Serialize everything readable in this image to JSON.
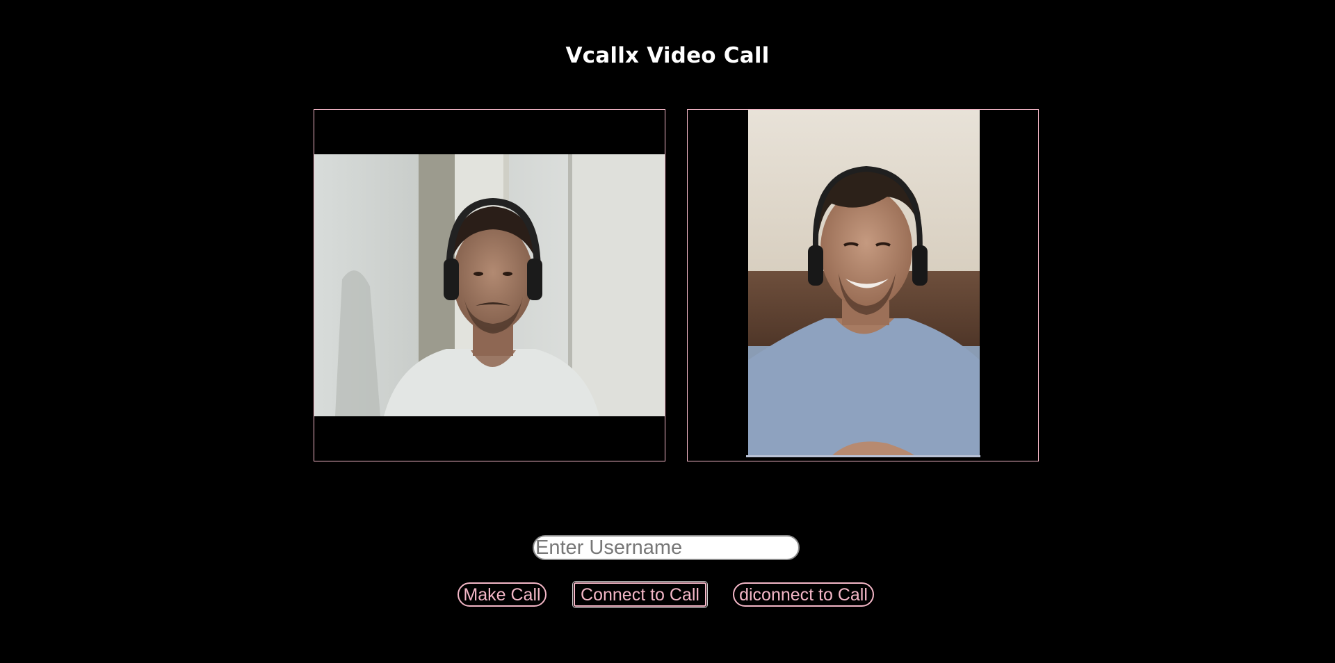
{
  "app": {
    "title": "Vcallx Video Call"
  },
  "videos": {
    "local": {
      "label": "local-video"
    },
    "remote": {
      "label": "remote-video"
    }
  },
  "controls": {
    "username_placeholder": "Enter Username",
    "username_value": "",
    "make_call_label": "Make Call",
    "connect_label": "Connect to Call",
    "disconnect_label": "diconnect to Call"
  },
  "colors": {
    "background": "#000000",
    "accent_pink": "#f4b7c7",
    "title_text": "#ffffff"
  }
}
